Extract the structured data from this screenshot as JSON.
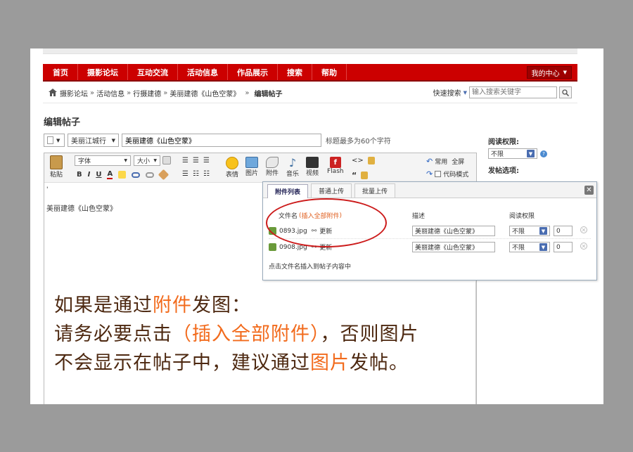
{
  "nav": {
    "items": [
      "首页",
      "摄影论坛",
      "互动交流",
      "活动信息",
      "作品展示",
      "搜索",
      "帮助"
    ],
    "my_center": "我的中心"
  },
  "breadcrumb": {
    "items": [
      "摄影论坛",
      "活动信息",
      "行摄建德",
      "美丽建德《山色空蒙》"
    ],
    "current": "编辑帖子",
    "quick_search_label": "快速搜索",
    "search_placeholder": "输入搜索关键字"
  },
  "page_title": "编辑帖子",
  "title_row": {
    "category": "美丽江城行",
    "title_value": "美丽建德《山色空蒙》",
    "hint": "标题最多为60个字符"
  },
  "toolbar": {
    "paste": "粘贴",
    "font": "字体",
    "size": "大小",
    "bold": "B",
    "italic": "I",
    "underline": "U",
    "emoji": "表情",
    "image": "图片",
    "attach": "附件",
    "music": "音乐",
    "video": "视频",
    "flash": "Flash",
    "common": "常用",
    "fullscreen": "全屏",
    "code_mode": "代码模式"
  },
  "editor_body": "美丽建德《山色空蒙》",
  "side": {
    "read_perm_label": "阅读权限:",
    "read_perm_value": "不限",
    "post_options_label": "发帖选项:"
  },
  "popup": {
    "tabs": [
      "附件列表",
      "普通上传",
      "批量上传"
    ],
    "col_filename": "文件名",
    "insert_all": "插入全部附件",
    "col_desc": "描述",
    "col_perm": "阅读权限",
    "rows": [
      {
        "file": "0893.jpg",
        "update": "更新",
        "desc": "美丽建德《山色空蒙》",
        "perm": "不限",
        "price": "0"
      },
      {
        "file": "0908.jpg",
        "update": "更新",
        "desc": "美丽建德《山色空蒙》",
        "perm": "不限",
        "price": "0"
      }
    ],
    "footer": "点击文件名插入到帖子内容中"
  },
  "annotation": {
    "line1_a": "如果是通过",
    "line1_hl": "附件",
    "line1_b": "发图：",
    "line2_a": "请务必要点击",
    "line2_hl": "（插入全部附件）",
    "line2_b": "，否则图片",
    "line3_a": "不会显示在帖子中，建议通过",
    "line3_hl": "图片",
    "line3_b": "发帖。"
  },
  "colors": {
    "nav_red": "#cc0000",
    "highlight_orange": "#f26b1d",
    "annotation_brown": "#4d2810",
    "ellipse_red": "#cc1b1b"
  }
}
